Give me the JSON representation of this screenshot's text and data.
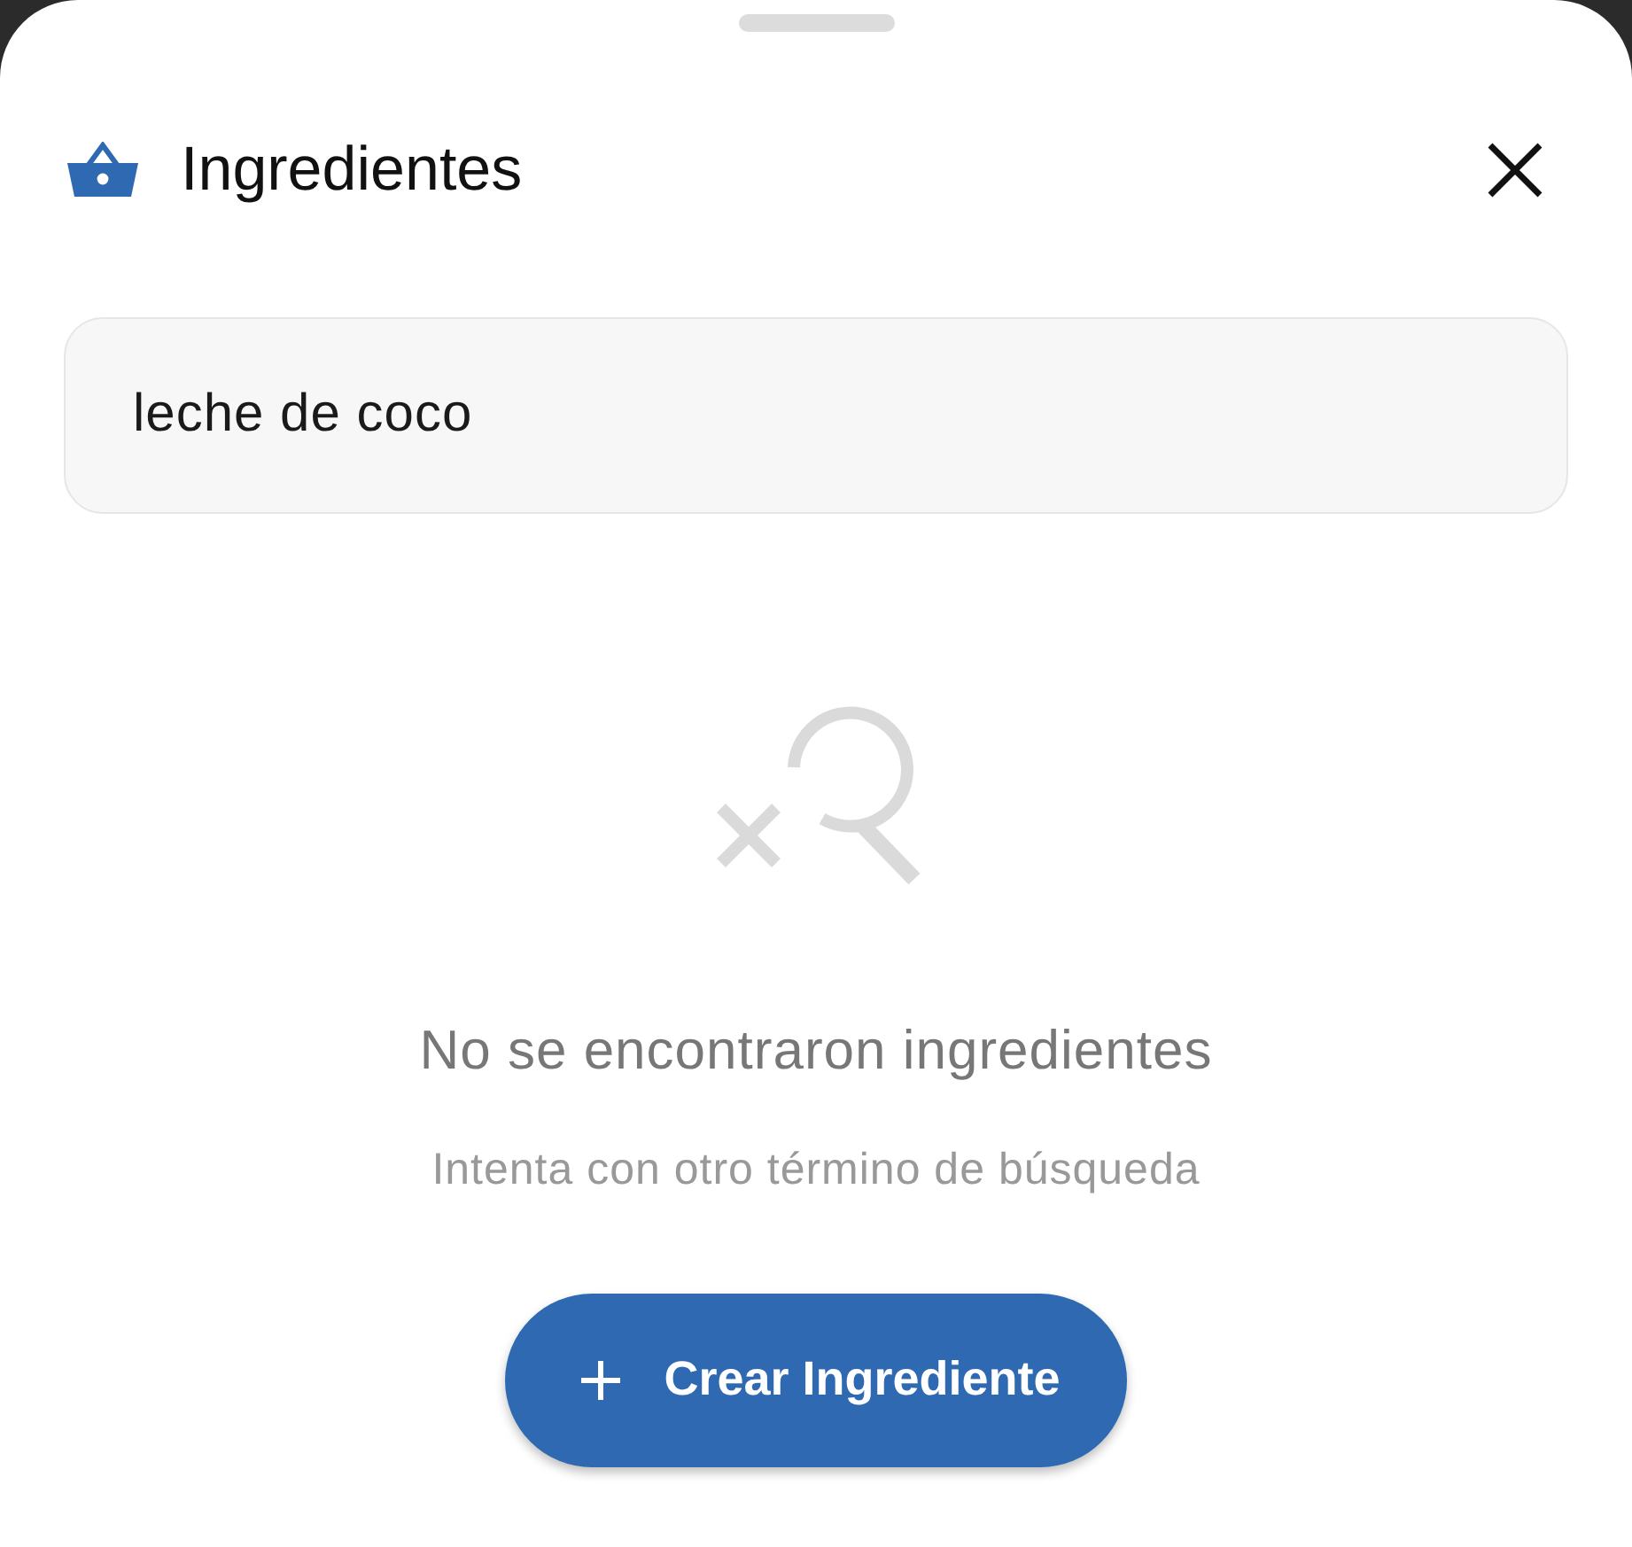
{
  "sheet": {
    "title": "Ingredientes"
  },
  "search": {
    "value": "leche de coco"
  },
  "empty_state": {
    "message": "No se encontraron ingredientes",
    "hint": "Intenta con otro término de búsqueda"
  },
  "action_button": {
    "label": "Crear Ingrediente"
  }
}
